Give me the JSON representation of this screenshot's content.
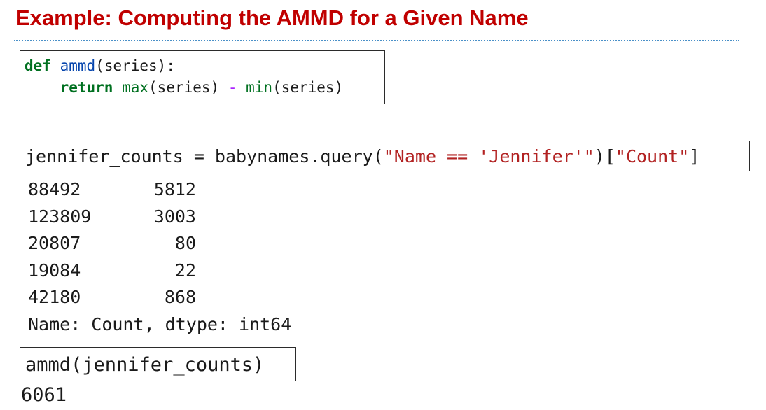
{
  "title": "Example: Computing the AMMD for a Given Name",
  "cell_def": {
    "def_kw": "def",
    "fn_name": "ammd",
    "sig_rest": "(series):",
    "indent": "    ",
    "return_kw": "return",
    "max_fn": "max",
    "max_arg": "(series) ",
    "minus": "-",
    "min_fn": "min",
    "min_arg": "(series)"
  },
  "cell_query": {
    "pre": "jennifer_counts = babynames.query(",
    "query_str": "\"Name == 'Jennifer'\"",
    "mid": ")[",
    "col_str": "\"Count\"",
    "post": "]"
  },
  "output": {
    "rows": [
      {
        "index": "88492",
        "value": "5812"
      },
      {
        "index": "123809",
        "value": "3003"
      },
      {
        "index": "20807",
        "value": "80"
      },
      {
        "index": "19084",
        "value": "22"
      },
      {
        "index": "42180",
        "value": "868"
      }
    ],
    "footer": "Name: Count, dtype: int64"
  },
  "cell_call": {
    "code": "ammd(jennifer_counts)"
  },
  "result": "6061"
}
